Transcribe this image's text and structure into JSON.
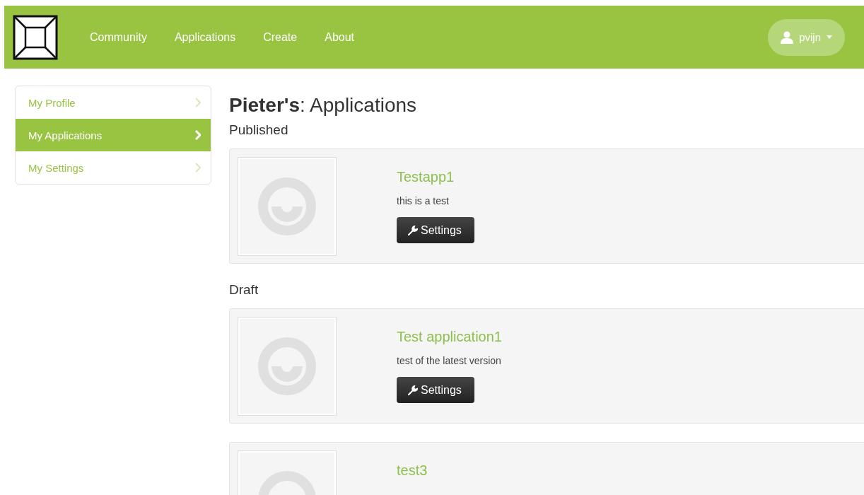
{
  "navbar": {
    "links": [
      "Community",
      "Applications",
      "Create",
      "About"
    ],
    "user": "pvijn"
  },
  "sidebar": {
    "items": [
      {
        "label": "My Profile",
        "selected": false
      },
      {
        "label": "My Applications",
        "selected": true
      },
      {
        "label": "My Settings",
        "selected": false
      }
    ]
  },
  "page_title": "**Pieter's**: Applications",
  "sections": [
    {
      "heading": "Published",
      "apps": [
        {
          "title": "Testapp1",
          "description": "this is a test",
          "button": "Settings"
        }
      ]
    },
    {
      "heading": "Draft",
      "apps": [
        {
          "title": "Test application1",
          "description": "test of the latest version",
          "button": "Settings"
        },
        {
          "title": "test3"
        }
      ]
    }
  ]
}
